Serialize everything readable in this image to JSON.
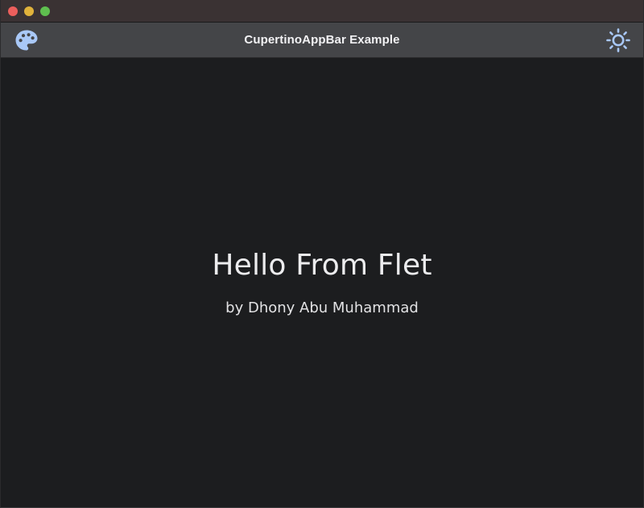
{
  "window": {
    "traffic_lights": {
      "close_color": "#ec5f5c",
      "minimize_color": "#e0b23b",
      "zoom_color": "#5fbf4f"
    }
  },
  "appbar": {
    "title": "CupertinoAppBar Example",
    "leading_icon": "palette-icon",
    "trailing_icon": "sun-icon",
    "icon_color": "#a9c8f7",
    "background": "#444548"
  },
  "main": {
    "heading": "Hello From Flet",
    "subheading": "by Dhony Abu Muhammad"
  }
}
